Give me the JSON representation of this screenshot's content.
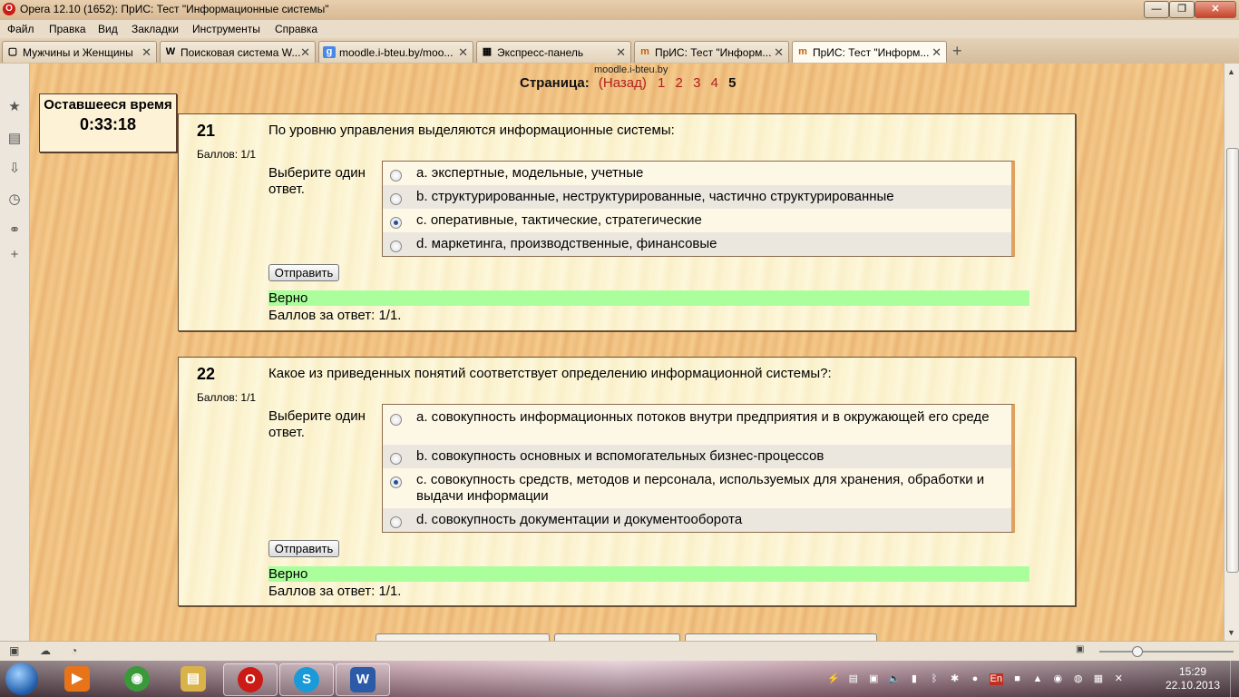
{
  "window": {
    "title": "Opera 12.10 (1652): ПрИС: Тест \"Информационные системы\"",
    "minimize": "—",
    "maximize": "❐",
    "close": "✕"
  },
  "menu": [
    "Файл",
    "Правка",
    "Вид",
    "Закладки",
    "Инструменты",
    "Справка"
  ],
  "tabs": [
    {
      "label": "Мужчины и Женщины",
      "icon": "page-icon",
      "glyph": "▢"
    },
    {
      "label": "Поисковая система W...",
      "icon": "wikipedia-icon",
      "glyph": "W"
    },
    {
      "label": "moodle.i-bteu.by/moo...",
      "icon": "google-icon",
      "glyph": "g"
    },
    {
      "label": "Экспресс-панель",
      "icon": "speed-dial-icon",
      "glyph": "▦"
    },
    {
      "label": "ПрИС: Тест \"Информ...",
      "icon": "moodle-icon",
      "glyph": "m"
    },
    {
      "label": "ПрИС: Тест \"Информ...",
      "icon": "moodle-icon",
      "glyph": "m"
    }
  ],
  "url_hint": "moodle.i-bteu.by",
  "page_nav": {
    "label": "Страница:",
    "back": "(Назад)",
    "pages": [
      "1",
      "2",
      "3",
      "4"
    ],
    "current": "5"
  },
  "timer": {
    "label": "Оставшееся время",
    "value": "0:33:18"
  },
  "questions": [
    {
      "number": "21",
      "score": "Баллов: 1/1",
      "text": "По уровню управления выделяются информационные системы:",
      "choose_label": "Выберите один ответ.",
      "options": [
        {
          "text": "a. экспертные, модельные, учетные",
          "checked": false
        },
        {
          "text": "b. структурированные, неструктурированные, частично структурированные",
          "checked": false
        },
        {
          "text": "c. оперативные, тактические, стратегические",
          "checked": true
        },
        {
          "text": "d. маркетинга, производственные, финансовые",
          "checked": false
        }
      ],
      "submit": "Отправить",
      "feedback": "Верно",
      "score_feedback": "Баллов за ответ: 1/1."
    },
    {
      "number": "22",
      "score": "Баллов: 1/1",
      "text": "Какое из приведенных понятий соответствует определению информационной системы?:",
      "choose_label": "Выберите один ответ.",
      "options": [
        {
          "text": "a. совокупность информационных потоков внутри предприятия и в окружающей его среде",
          "checked": false
        },
        {
          "text": "b. совокупность основных и вспомогательных бизнес-процессов",
          "checked": false
        },
        {
          "text": "c. совокупность средств, методов и персонала, используемых для хранения, обработки и выдачи информации",
          "checked": true
        },
        {
          "text": "d. совокупность документации и документооборота",
          "checked": false
        }
      ],
      "submit": "Отправить",
      "feedback": "Верно",
      "score_feedback": "Баллов за ответ: 1/1."
    }
  ],
  "sidebar_icons": [
    "bookmarks-star-icon",
    "notes-icon",
    "downloads-icon",
    "history-icon",
    "links-icon",
    "add-panel-icon"
  ],
  "taskbar": {
    "apps": [
      {
        "name": "media-player-icon",
        "open": false,
        "color": "#e8741a",
        "glyph": "▶"
      },
      {
        "name": "chrome-icon",
        "open": false,
        "color": "#3a9a3a",
        "glyph": "◉"
      },
      {
        "name": "explorer-folder-icon",
        "open": false,
        "color": "#d9b24a",
        "glyph": "▤"
      },
      {
        "name": "opera-icon",
        "open": true,
        "color": "#cc1a14",
        "glyph": "O"
      },
      {
        "name": "skype-icon",
        "open": true,
        "color": "#1a9ad8",
        "glyph": "S"
      },
      {
        "name": "word-icon",
        "open": true,
        "color": "#2a5aa8",
        "glyph": "W"
      }
    ],
    "language": "En",
    "time": "15:29",
    "date": "22.10.2013"
  }
}
